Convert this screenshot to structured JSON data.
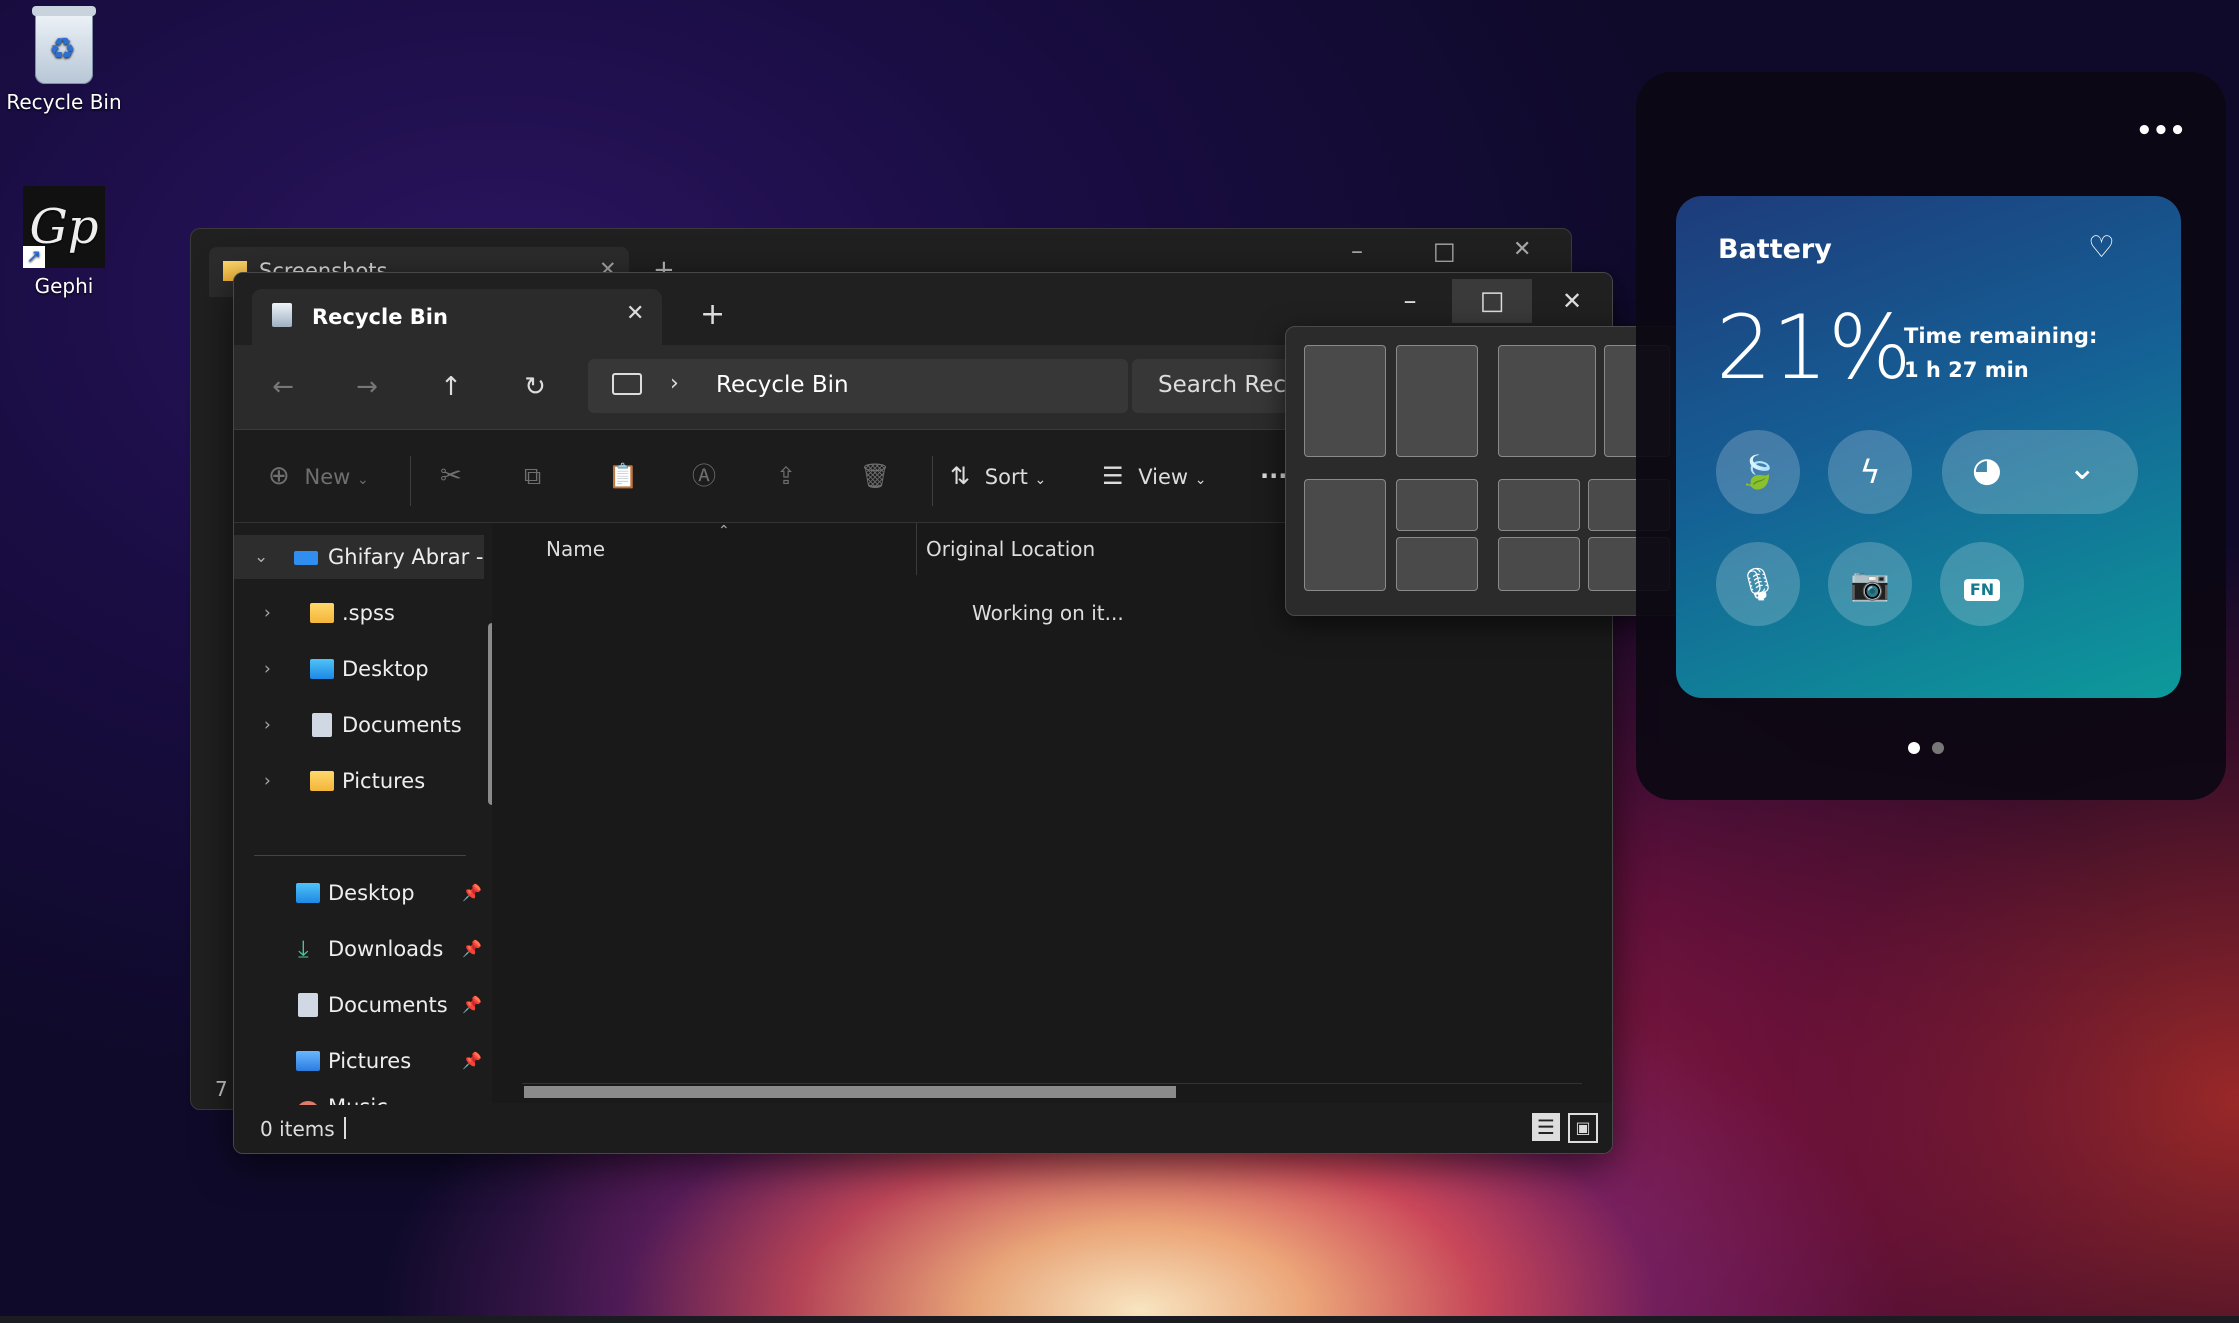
{
  "desktop": {
    "icons": [
      {
        "label": "Recycle Bin"
      },
      {
        "label": "Gephi"
      }
    ]
  },
  "back_window": {
    "tab_title": "Screenshots",
    "item_count_fragment": "7"
  },
  "explorer": {
    "tab_title": "Recycle Bin",
    "new_tab": "+",
    "window_controls": {
      "minimize": "–",
      "maximize": "□",
      "close": "✕"
    },
    "address": {
      "breadcrumb": "Recycle Bin"
    },
    "search": {
      "placeholder": "Search Recy"
    },
    "toolbar": {
      "new_label": "New",
      "sort_label": "Sort",
      "view_label": "View",
      "more_label": "···"
    },
    "sidebar": {
      "account": "Ghifary Abrar - F",
      "tree_items": [
        {
          "label": ".spss",
          "icon": "folder-icon"
        },
        {
          "label": "Desktop",
          "icon": "desktop-icon"
        },
        {
          "label": "Documents",
          "icon": "documents-icon"
        },
        {
          "label": "Pictures",
          "icon": "folder-icon"
        }
      ],
      "quick_access": [
        {
          "label": "Desktop",
          "icon": "desktop-icon"
        },
        {
          "label": "Downloads",
          "icon": "download-icon"
        },
        {
          "label": "Documents",
          "icon": "documents-icon"
        },
        {
          "label": "Pictures",
          "icon": "pictures-icon"
        },
        {
          "label": "Music",
          "icon": "music-icon"
        }
      ]
    },
    "columns": {
      "name": "Name",
      "original_location": "Original Location"
    },
    "loading_text": "Working on it...",
    "status": {
      "items": "0 items"
    }
  },
  "snap_layouts": {
    "layouts": [
      "two-equal",
      "two-wide-narrow",
      "one-plus-two",
      "four-grid"
    ]
  },
  "battery_widget": {
    "title": "Battery",
    "percent": "21%",
    "time_label": "Time remaining:",
    "time_value": "1 h 27 min",
    "more": "•••",
    "buttons": [
      "battery-saver-icon",
      "lightning-icon",
      "performance-icon",
      "chevron-down-icon",
      "microphone-icon",
      "camera-icon",
      "fn-key-icon"
    ],
    "fn_label": "FN",
    "page_indicator": {
      "count": 2,
      "active": 0
    }
  },
  "colors": {
    "accent": "#2f8ef0",
    "card_start": "#1e3b7a",
    "card_end": "#0d9a9b",
    "window_bg": "#1c1c1c"
  }
}
